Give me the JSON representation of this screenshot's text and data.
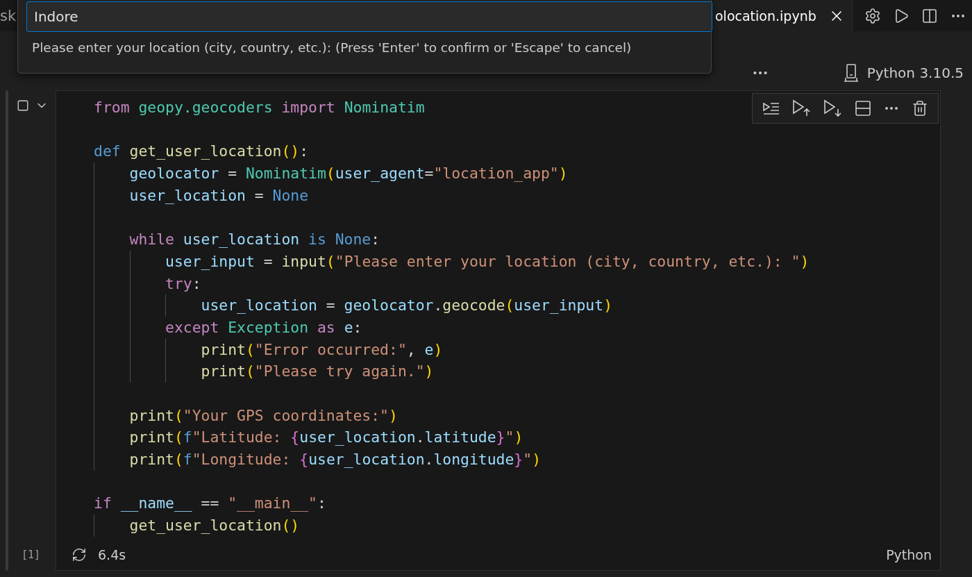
{
  "tabs": [
    {
      "label": "sk",
      "selected": false
    },
    {
      "label": "olocation.ipynb",
      "selected": true
    }
  ],
  "quick_input": {
    "value": "Indore",
    "message": "Please enter your location (city, country, etc.): (Press 'Enter' to confirm or 'Escape' to cancel)"
  },
  "kernel": "Python 3.10.5",
  "cell": {
    "execution_count": "[1]",
    "duration": "6.4s",
    "language": "Python",
    "lines": [
      {
        "kind": "code",
        "tokens": [
          {
            "kind": "kw",
            "text": "from "
          },
          {
            "kind": "cls",
            "text": "geopy.geocoders "
          },
          {
            "kind": "kw",
            "text": "import "
          },
          {
            "kind": "cls",
            "text": "Nominatim"
          }
        ]
      },
      {
        "kind": "blank"
      },
      {
        "kind": "code",
        "tokens": [
          {
            "kind": "storage",
            "text": "def "
          },
          {
            "kind": "fn",
            "text": "get_user_location"
          },
          {
            "kind": "paren",
            "text": "()"
          },
          {
            "kind": "plain",
            "text": ":"
          }
        ]
      },
      {
        "kind": "code",
        "tokens": [
          {
            "kind": "var",
            "text": "    geolocator"
          },
          {
            "kind": "plain",
            "text": " = "
          },
          {
            "kind": "cls",
            "text": "Nominatim"
          },
          {
            "kind": "paren",
            "text": "("
          },
          {
            "kind": "var",
            "text": "user_agent"
          },
          {
            "kind": "plain",
            "text": "="
          },
          {
            "kind": "str",
            "text": "\"location_app\""
          },
          {
            "kind": "paren",
            "text": ")"
          }
        ]
      },
      {
        "kind": "code",
        "tokens": [
          {
            "kind": "var",
            "text": "    user_location"
          },
          {
            "kind": "plain",
            "text": " = "
          },
          {
            "kind": "storage",
            "text": "None"
          }
        ]
      },
      {
        "kind": "blank"
      },
      {
        "kind": "code",
        "tokens": [
          {
            "kind": "kw",
            "text": "    while "
          },
          {
            "kind": "var",
            "text": "user_location "
          },
          {
            "kind": "storage",
            "text": "is "
          },
          {
            "kind": "storage",
            "text": "None"
          },
          {
            "kind": "plain",
            "text": ":"
          }
        ]
      },
      {
        "kind": "code",
        "tokens": [
          {
            "kind": "var",
            "text": "        user_input"
          },
          {
            "kind": "plain",
            "text": " = "
          },
          {
            "kind": "fn",
            "text": "input"
          },
          {
            "kind": "paren",
            "text": "("
          },
          {
            "kind": "str",
            "text": "\"Please enter your location (city, country, etc.): \""
          },
          {
            "kind": "paren",
            "text": ")"
          }
        ]
      },
      {
        "kind": "code",
        "tokens": [
          {
            "kind": "kw",
            "text": "        try"
          },
          {
            "kind": "plain",
            "text": ":"
          }
        ]
      },
      {
        "kind": "code",
        "tokens": [
          {
            "kind": "var",
            "text": "            user_location"
          },
          {
            "kind": "plain",
            "text": " = "
          },
          {
            "kind": "var",
            "text": "geolocator"
          },
          {
            "kind": "plain",
            "text": "."
          },
          {
            "kind": "fn",
            "text": "geocode"
          },
          {
            "kind": "paren",
            "text": "("
          },
          {
            "kind": "var",
            "text": "user_input"
          },
          {
            "kind": "paren",
            "text": ")"
          }
        ]
      },
      {
        "kind": "code",
        "tokens": [
          {
            "kind": "kw",
            "text": "        except "
          },
          {
            "kind": "cls",
            "text": "Exception "
          },
          {
            "kind": "kw",
            "text": "as "
          },
          {
            "kind": "var",
            "text": "e"
          },
          {
            "kind": "plain",
            "text": ":"
          }
        ]
      },
      {
        "kind": "code",
        "tokens": [
          {
            "kind": "fn",
            "text": "            print"
          },
          {
            "kind": "paren",
            "text": "("
          },
          {
            "kind": "str",
            "text": "\"Error occurred:\""
          },
          {
            "kind": "plain",
            "text": ", "
          },
          {
            "kind": "var",
            "text": "e"
          },
          {
            "kind": "paren",
            "text": ")"
          }
        ]
      },
      {
        "kind": "code",
        "tokens": [
          {
            "kind": "fn",
            "text": "            print"
          },
          {
            "kind": "paren",
            "text": "("
          },
          {
            "kind": "str",
            "text": "\"Please try again.\""
          },
          {
            "kind": "paren",
            "text": ")"
          }
        ]
      },
      {
        "kind": "blank"
      },
      {
        "kind": "code",
        "tokens": [
          {
            "kind": "fn",
            "text": "    print"
          },
          {
            "kind": "paren",
            "text": "("
          },
          {
            "kind": "str",
            "text": "\"Your GPS coordinates:\""
          },
          {
            "kind": "paren",
            "text": ")"
          }
        ]
      },
      {
        "kind": "code",
        "tokens": [
          {
            "kind": "fn",
            "text": "    print"
          },
          {
            "kind": "paren",
            "text": "("
          },
          {
            "kind": "storage",
            "text": "f"
          },
          {
            "kind": "str",
            "text": "\"Latitude: "
          },
          {
            "kind": "brace",
            "text": "{"
          },
          {
            "kind": "var",
            "text": "user_location"
          },
          {
            "kind": "plain",
            "text": "."
          },
          {
            "kind": "var",
            "text": "latitude"
          },
          {
            "kind": "brace",
            "text": "}"
          },
          {
            "kind": "str",
            "text": "\""
          },
          {
            "kind": "paren",
            "text": ")"
          }
        ]
      },
      {
        "kind": "code",
        "tokens": [
          {
            "kind": "fn",
            "text": "    print"
          },
          {
            "kind": "paren",
            "text": "("
          },
          {
            "kind": "storage",
            "text": "f"
          },
          {
            "kind": "str",
            "text": "\"Longitude: "
          },
          {
            "kind": "brace",
            "text": "{"
          },
          {
            "kind": "var",
            "text": "user_location"
          },
          {
            "kind": "plain",
            "text": "."
          },
          {
            "kind": "var",
            "text": "longitude"
          },
          {
            "kind": "brace",
            "text": "}"
          },
          {
            "kind": "str",
            "text": "\""
          },
          {
            "kind": "paren",
            "text": ")"
          }
        ]
      },
      {
        "kind": "blank"
      },
      {
        "kind": "code",
        "tokens": [
          {
            "kind": "kw",
            "text": "if "
          },
          {
            "kind": "var",
            "text": "__name__"
          },
          {
            "kind": "plain",
            "text": " == "
          },
          {
            "kind": "str",
            "text": "\"__main__\""
          },
          {
            "kind": "plain",
            "text": ":"
          }
        ]
      },
      {
        "kind": "code",
        "tokens": [
          {
            "kind": "fn",
            "text": "    get_user_location"
          },
          {
            "kind": "paren",
            "text": "()"
          }
        ]
      }
    ]
  }
}
